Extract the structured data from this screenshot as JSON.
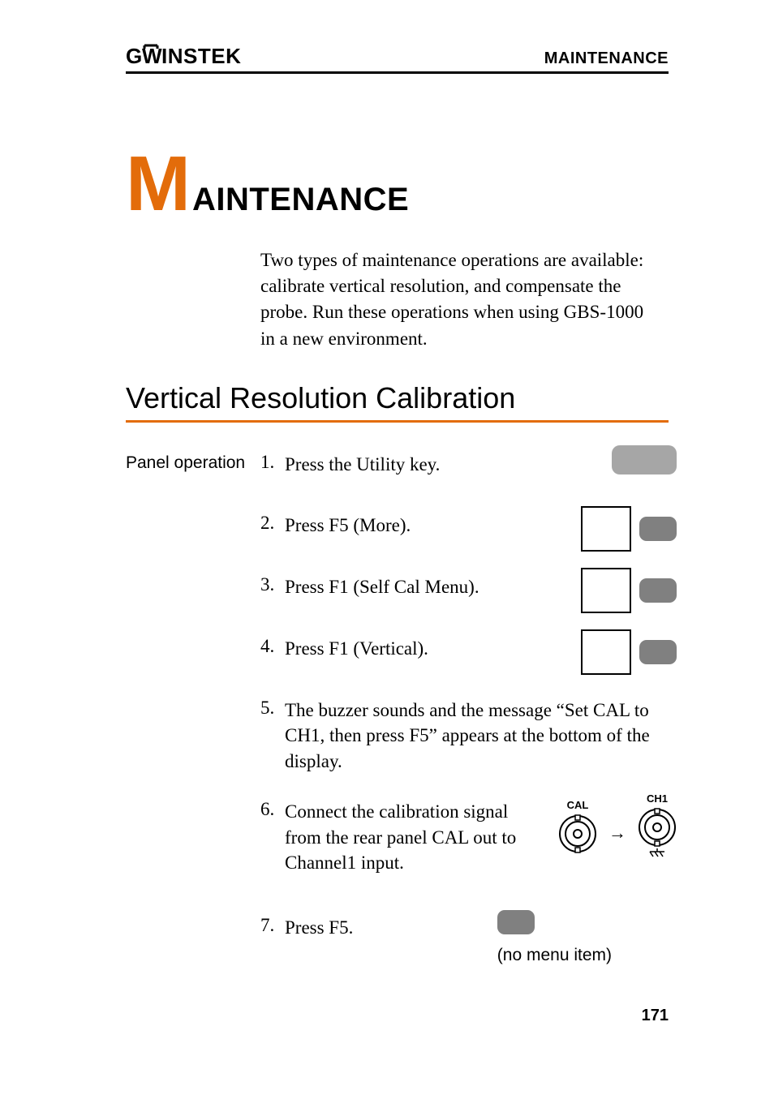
{
  "header": {
    "logo_text": "GWINSTEK",
    "top_right": "MAINTENANCE"
  },
  "chapter": {
    "letter": "M",
    "rest": "AINTENANCE"
  },
  "intro": "Two types of maintenance operations are available: calibrate vertical resolution, and compensate the probe. Run these operations when using GBS-1000 in a new environment.",
  "section_heading": "Vertical Resolution Calibration",
  "left_label": "Panel operation",
  "steps": [
    {
      "num": "1.",
      "text": "Press the Utility key."
    },
    {
      "num": "2.",
      "text": "Press F5 (More)."
    },
    {
      "num": "3.",
      "text": "Press F1 (Self Cal Menu)."
    },
    {
      "num": "4.",
      "text": "Press F1 (Vertical)."
    },
    {
      "num": "5.",
      "text": "The buzzer sounds and the message “Set CAL to CH1, then press F5” appears at the bottom of the display."
    },
    {
      "num": "6.",
      "text": "Connect the calibration signal from the rear panel CAL out to Channel1 input."
    },
    {
      "num": "7.",
      "text": "Press F5."
    }
  ],
  "bnc": {
    "left": "CAL",
    "right": "CH1"
  },
  "no_menu": "(no menu item)",
  "page_number": "171"
}
